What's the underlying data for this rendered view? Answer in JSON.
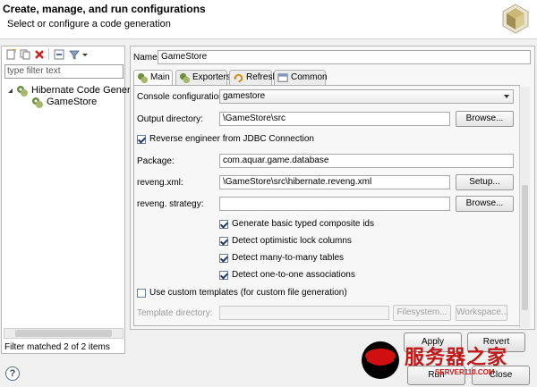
{
  "header": {
    "title": "Create, manage, and run configurations",
    "subtitle": "Select or configure a code generation"
  },
  "left": {
    "filter_placeholder": "type filter text",
    "tree": [
      {
        "label": "Hibernate Code Generatic",
        "icon": "hibernate-icon"
      },
      {
        "label": "GameStore",
        "icon": "hibernate-config-icon"
      }
    ],
    "status": "Filter matched 2 of 2 items"
  },
  "config": {
    "name_label": "Name:",
    "name_value": "GameStore",
    "tabs": [
      {
        "label": "Main",
        "icon": "hibernate-icon"
      },
      {
        "label": "Exporters",
        "icon": "hibernate-icon"
      },
      {
        "label": "Refresh",
        "icon": "refresh-icon"
      },
      {
        "label": "Common",
        "icon": "common-icon"
      }
    ],
    "console_label": "Console configuration:",
    "console_value": "gamestore",
    "output_label": "Output directory:",
    "output_value": "\\GameStore\\src",
    "browse_label": "Browse...",
    "reverse_label": "Reverse engineer from JDBC Connection",
    "package_label": "Package:",
    "package_value": "com.aquar.game.database",
    "reveng_label": "reveng.xml:",
    "reveng_value": "\\GameStore\\src\\hibernate.reveng.xml",
    "setup_label": "Setup...",
    "strategy_label": "reveng. strategy:",
    "strategy_value": "",
    "options": [
      "Generate basic typed composite ids",
      "Detect optimistic lock columns",
      "Detect many-to-many tables",
      "Detect one-to-one associations"
    ],
    "custom_templates_label": "Use custom templates (for custom file generation)",
    "template_dir_label": "Template directory:",
    "filesystem_label": "Filesystem...",
    "workspace_label": "Workspace..."
  },
  "buttons": {
    "apply": "Apply",
    "revert": "Revert",
    "run": "Run",
    "close": "Close",
    "help": "?"
  },
  "watermark": {
    "cn": "服务器之家",
    "en": "SERVER110.COM"
  },
  "colors": {
    "watermark": "#c21818"
  }
}
